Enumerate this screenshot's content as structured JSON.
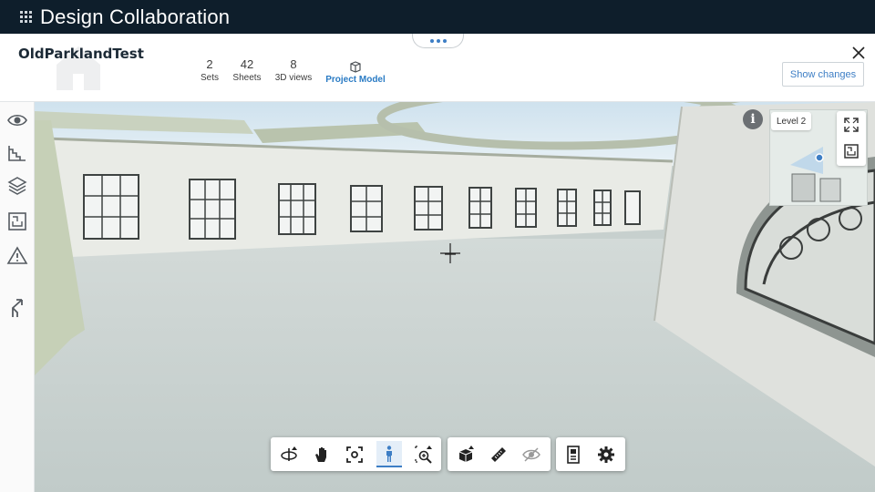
{
  "app": {
    "title": "Design Collaboration"
  },
  "project": {
    "name": "OldParklandTest",
    "stats": [
      {
        "value": "2",
        "label": "Sets"
      },
      {
        "value": "42",
        "label": "Sheets"
      },
      {
        "value": "8",
        "label": "3D views"
      },
      {
        "value": "",
        "label": "Project Model"
      }
    ],
    "show_changes_label": "Show changes"
  },
  "sidebar": {
    "items": [
      {
        "icon": "eye-icon"
      },
      {
        "icon": "stairs-icon"
      },
      {
        "icon": "layers-icon"
      },
      {
        "icon": "floorplan-icon"
      },
      {
        "icon": "warning-icon"
      },
      {
        "icon": "branch-icon"
      }
    ]
  },
  "viewer": {
    "level_label": "Level 2",
    "info_label": "i"
  },
  "toolbar": {
    "groups": [
      {
        "tools": [
          "orbit-icon",
          "pan-hand-icon",
          "focus-icon",
          "first-person-icon",
          "zoom-window-icon"
        ]
      },
      {
        "tools": [
          "section-box-icon",
          "measure-ruler-icon",
          "visibility-icon"
        ]
      },
      {
        "tools": [
          "properties-icon",
          "settings-gear-icon"
        ]
      }
    ],
    "active_tool": "first-person-icon"
  },
  "colors": {
    "appbar": "#0e1e2b",
    "accent": "#3d7ec5",
    "floor": "#c7d0ce",
    "wall": "#e8eae6"
  }
}
